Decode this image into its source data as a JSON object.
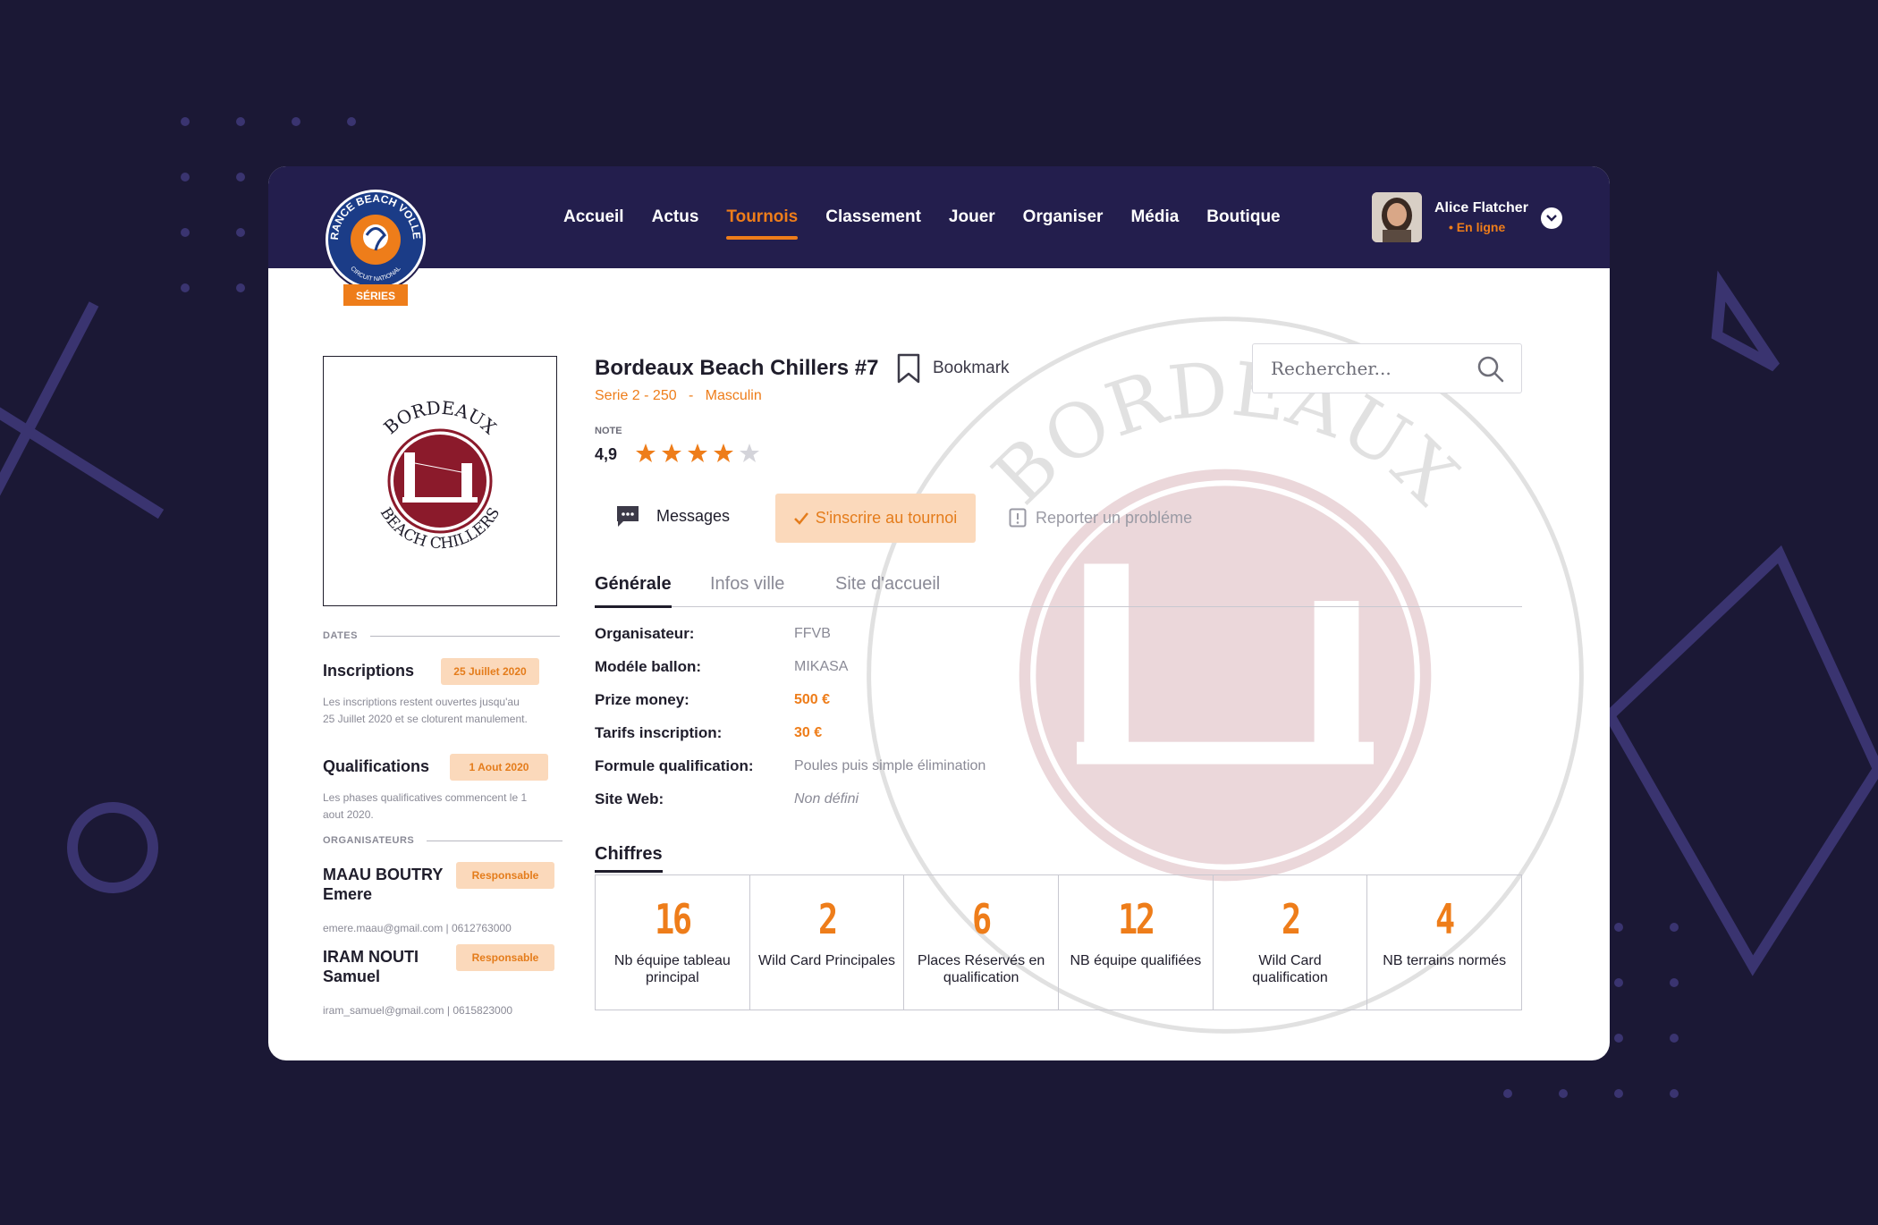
{
  "header": {
    "logo_text": "FRANCE BEACH VOLLEY",
    "logo_sub": "CIRCUIT NATIONAL",
    "logo_badge": "SÉRIES",
    "nav": [
      {
        "label": "Accueil"
      },
      {
        "label": "Actus"
      },
      {
        "label": "Tournois",
        "active": true
      },
      {
        "label": "Classement"
      },
      {
        "label": "Jouer"
      },
      {
        "label": "Organiser"
      },
      {
        "label": "Média"
      },
      {
        "label": "Boutique"
      }
    ],
    "user": {
      "name": "Alice Flatcher",
      "status": "• En ligne"
    }
  },
  "club_logo": {
    "top_text": "BORDEAUX",
    "bottom_text": "BEACH CHILLERS"
  },
  "tournament": {
    "name": "Bordeaux Beach Chillers #7",
    "bookmark_label": "Bookmark",
    "subtitle": "Serie 2 - 250   -   Masculin",
    "note_label": "NOTE",
    "note_value": "4,9",
    "stars_filled": 4,
    "stars_total": 5
  },
  "actions": {
    "messages": "Messages",
    "join": "S'inscrire au tournoi",
    "report": "Reporter un probléme"
  },
  "search": {
    "placeholder": "Rechercher..."
  },
  "tabs": [
    "Générale",
    "Infos ville",
    "Site d'accueil"
  ],
  "info": [
    {
      "label": "Organisateur:",
      "value": "FFVB",
      "style": "normal"
    },
    {
      "label": "Modéle ballon:",
      "value": "MIKASA",
      "style": "normal"
    },
    {
      "label": "Prize money:",
      "value": "500 €",
      "style": "orange"
    },
    {
      "label": "Tarifs inscription:",
      "value": "30 €",
      "style": "orange"
    },
    {
      "label": "Formule qualification:",
      "value": "Poules puis simple élimination",
      "style": "normal"
    },
    {
      "label": "Site Web:",
      "value": "Non défini",
      "style": "italic"
    }
  ],
  "chiffres": {
    "title": "Chiffres",
    "stats": [
      {
        "value": "16",
        "label": "Nb équipe tableau principal"
      },
      {
        "value": "2",
        "label": "Wild Card Principales"
      },
      {
        "value": "6",
        "label": "Places Réservés en qualification"
      },
      {
        "value": "12",
        "label": "NB équipe qualifiées"
      },
      {
        "value": "2",
        "label": "Wild Card qualification"
      },
      {
        "value": "4",
        "label": "NB terrains normés"
      }
    ]
  },
  "left": {
    "dates_label": "DATES",
    "inscriptions": {
      "title": "Inscriptions",
      "date": "25 Juillet 2020",
      "text1": "Les inscriptions restent ouvertes jusqu'au",
      "text2": "25 Juillet 2020 et se cloturent manulement."
    },
    "qualifications": {
      "title": "Qualifications",
      "date": "1 Aout 2020",
      "text1": "Les phases qualificatives  commencent le 1",
      "text2": "aout 2020."
    },
    "organisateurs_label": "ORGANISATEURS",
    "organisateurs": [
      {
        "name1": "MAAU BOUTRY",
        "name2": "Emere",
        "role": "Responsable",
        "contact": "emere.maau@gmail.com | 0612763000"
      },
      {
        "name1": "IRAM NOUTI",
        "name2": "Samuel",
        "role": "Responsable",
        "contact": "iram_samuel@gmail.com | 0615823000"
      }
    ]
  },
  "colors": {
    "accent": "#ee7d1a",
    "navy": "#231e4d",
    "background": "#1b1835",
    "pill": "#fbd9bb",
    "club_red": "#8b1a2b"
  }
}
